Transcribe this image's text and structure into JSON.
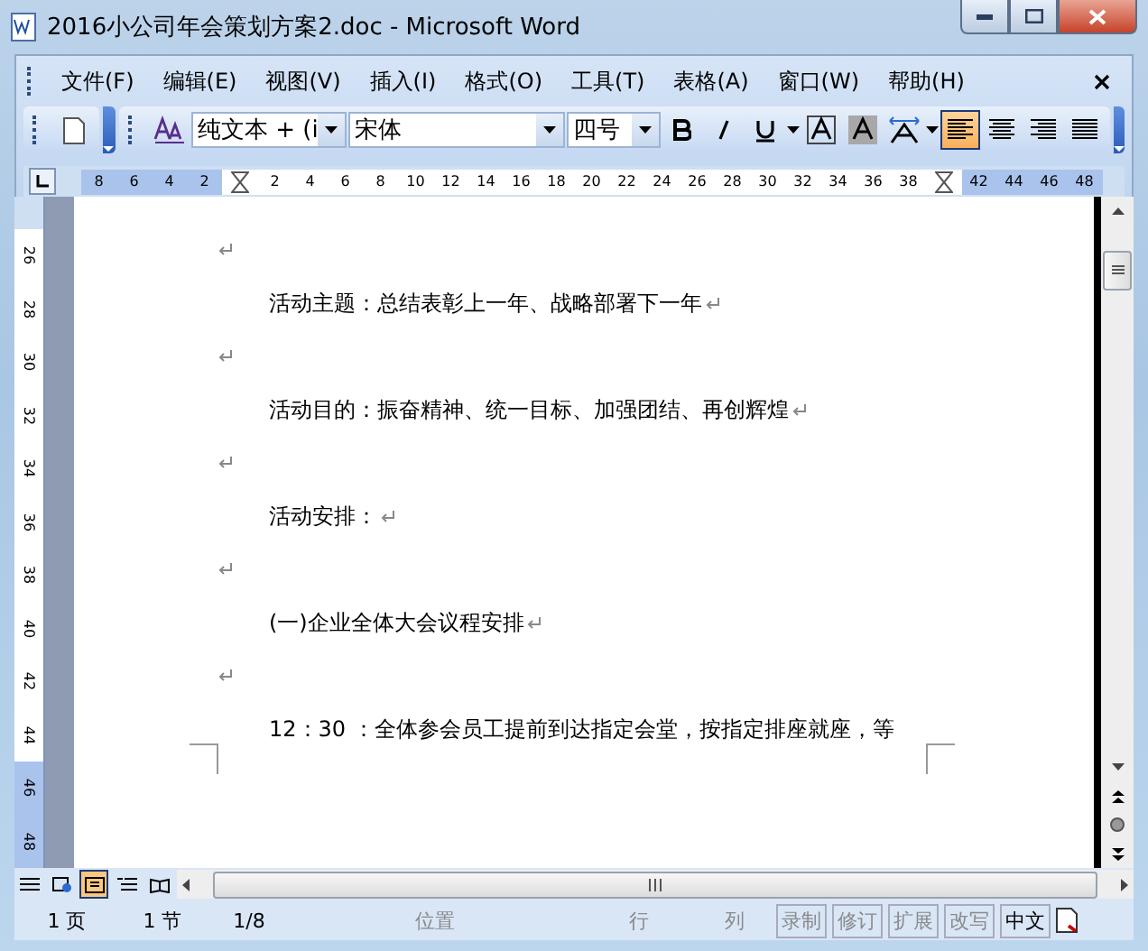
{
  "window": {
    "title": "2016小公司年会策划方案2.doc - Microsoft Word"
  },
  "menu": [
    "文件(F)",
    "编辑(E)",
    "视图(V)",
    "插入(I)",
    "格式(O)",
    "工具(T)",
    "表格(A)",
    "窗口(W)",
    "帮助(H)"
  ],
  "toolbar": {
    "style": "纯文本 + (i",
    "font": "宋体",
    "size": "四号",
    "align_buttons": [
      {
        "kind": "left",
        "selected": true
      },
      {
        "kind": "center",
        "selected": false
      },
      {
        "kind": "right",
        "selected": false
      },
      {
        "kind": "justify",
        "selected": false
      }
    ]
  },
  "ruler": {
    "ticks": [
      {
        "label": "8",
        "margin": true
      },
      {
        "label": "6",
        "margin": true
      },
      {
        "label": "4",
        "margin": true
      },
      {
        "label": "2",
        "margin": true
      },
      {
        "label": "2",
        "margin": false
      },
      {
        "label": "4",
        "margin": false
      },
      {
        "label": "6",
        "margin": false
      },
      {
        "label": "8",
        "margin": false
      },
      {
        "label": "10",
        "margin": false
      },
      {
        "label": "12",
        "margin": false
      },
      {
        "label": "14",
        "margin": false
      },
      {
        "label": "16",
        "margin": false
      },
      {
        "label": "18",
        "margin": false
      },
      {
        "label": "20",
        "margin": false
      },
      {
        "label": "22",
        "margin": false
      },
      {
        "label": "24",
        "margin": false
      },
      {
        "label": "26",
        "margin": false
      },
      {
        "label": "28",
        "margin": false
      },
      {
        "label": "30",
        "margin": false
      },
      {
        "label": "32",
        "margin": false
      },
      {
        "label": "34",
        "margin": false
      },
      {
        "label": "36",
        "margin": false
      },
      {
        "label": "38",
        "margin": false
      },
      {
        "label": "42",
        "margin": true
      },
      {
        "label": "44",
        "margin": true
      },
      {
        "label": "46",
        "margin": true
      },
      {
        "label": "48",
        "margin": true
      }
    ],
    "vertical": [
      {
        "label": "26",
        "margin": false
      },
      {
        "label": "28",
        "margin": false
      },
      {
        "label": "30",
        "margin": false
      },
      {
        "label": "32",
        "margin": false
      },
      {
        "label": "34",
        "margin": false
      },
      {
        "label": "36",
        "margin": false
      },
      {
        "label": "38",
        "margin": false
      },
      {
        "label": "40",
        "margin": false
      },
      {
        "label": "42",
        "margin": false
      },
      {
        "label": "44",
        "margin": false
      },
      {
        "label": "46",
        "margin": true
      },
      {
        "label": "48",
        "margin": true
      }
    ]
  },
  "document": {
    "paragraphs": [
      {
        "kind": "empty",
        "mark": true
      },
      {
        "kind": "text",
        "text": "活动主题：总结表彰上一年、战略部署下一年",
        "mark": true
      },
      {
        "kind": "empty",
        "mark": true
      },
      {
        "kind": "text",
        "text": "活动目的：振奋精神、统一目标、加强团结、再创辉煌",
        "mark": true
      },
      {
        "kind": "empty",
        "mark": true
      },
      {
        "kind": "text",
        "text": "活动安排：",
        "mark": true
      },
      {
        "kind": "empty",
        "mark": true
      },
      {
        "kind": "text",
        "text": "(一)企业全体大会议程安排",
        "mark": true
      },
      {
        "kind": "empty",
        "mark": true
      },
      {
        "kind": "text",
        "text": "12：30 ：全体参会员工提前到达指定会堂，按指定排座就座，等",
        "mark": false
      }
    ]
  },
  "view_buttons": [
    {
      "kind": "normal",
      "selected": false
    },
    {
      "kind": "web",
      "selected": false
    },
    {
      "kind": "print",
      "selected": true
    },
    {
      "kind": "outline",
      "selected": false
    },
    {
      "kind": "reading",
      "selected": false
    }
  ],
  "status_bar": {
    "cells": [
      {
        "text": "1 页",
        "disabled": false
      },
      {
        "text": "1 节",
        "disabled": false
      },
      {
        "text": "1/8",
        "disabled": false
      },
      {
        "text": "位置",
        "disabled": true
      },
      {
        "text": "行",
        "disabled": true
      },
      {
        "text": "列",
        "disabled": true
      }
    ],
    "modes": [
      {
        "text": "录制",
        "disabled": true
      },
      {
        "text": "修订",
        "disabled": true
      },
      {
        "text": "扩展",
        "disabled": true
      },
      {
        "text": "改写",
        "disabled": true
      },
      {
        "text": "中文",
        "disabled": false
      }
    ]
  }
}
